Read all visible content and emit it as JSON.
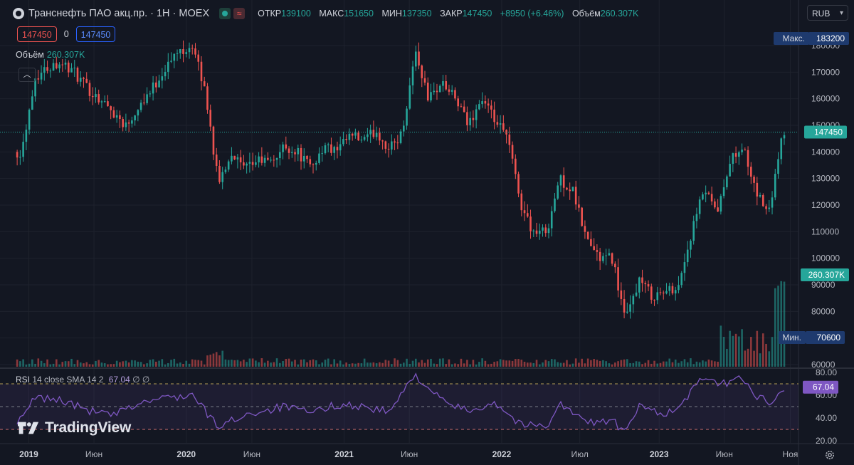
{
  "header": {
    "title": "Транснефть ПАО акц.пр. · 1Н · MOEX",
    "open_label": "ОТКР",
    "open_value": "139100",
    "high_label": "МАКС",
    "high_value": "151650",
    "low_label": "МИН",
    "low_value": "137350",
    "close_label": "ЗАКР",
    "close_value": "147450",
    "change_value": "+8950 (+6.46%)",
    "volume_label": "Объём",
    "volume_value": "260.307K"
  },
  "currency": "RUB",
  "trade_boxes": {
    "sell": "147450",
    "spread": "0",
    "buy": "147450"
  },
  "volume_legend": {
    "label": "Объём",
    "value": "260.307K"
  },
  "rsi_legend": {
    "label": "RSI",
    "params": "14 close SMA 14 2",
    "value": "67.04",
    "extra": "∅ ∅"
  },
  "brand": "TradingView",
  "colors": {
    "background": "#131722",
    "up": "#26a69a",
    "down": "#ef5350",
    "rsi": "#7e57c2",
    "grid": "#1e222d",
    "text": "#d1d4dc"
  },
  "icons": [
    "logo-icon",
    "eye-icon",
    "chevron-down-icon",
    "chevron-up-icon",
    "gear-icon"
  ],
  "chart_data": [
    {
      "type": "candlestick",
      "title": "Транснефть ПАО акц.пр. · 1Н · MOEX",
      "y_axis": {
        "ticks": [
          "180000",
          "170000",
          "160000",
          "150000",
          "140000",
          "130000",
          "120000",
          "110000",
          "100000",
          "90000",
          "80000",
          "70000",
          "60000"
        ],
        "range": [
          60000,
          180000
        ]
      },
      "x_axis": {
        "labels": [
          "2019",
          "Июн",
          "2020",
          "Июн",
          "2021",
          "Июн",
          "2022",
          "Июл",
          "2023",
          "Июн",
          "Ноя"
        ]
      },
      "price_badges": {
        "max_label": "Макс.",
        "max": "183200",
        "last": "147450",
        "volume": "260.307K",
        "min_label": "Мин.",
        "min": "70600"
      },
      "anchors": [
        {
          "t": "2018-12",
          "v": 140000
        },
        {
          "t": "2019-01",
          "v": 168000
        },
        {
          "t": "2019-02",
          "v": 172000
        },
        {
          "t": "2019-03",
          "v": 174000
        },
        {
          "t": "2019-04",
          "v": 170000
        },
        {
          "t": "2019-05",
          "v": 164000
        },
        {
          "t": "2019-06",
          "v": 160000
        },
        {
          "t": "2019-07",
          "v": 155000
        },
        {
          "t": "2019-08",
          "v": 150000
        },
        {
          "t": "2019-09",
          "v": 158000
        },
        {
          "t": "2019-10",
          "v": 164000
        },
        {
          "t": "2019-11",
          "v": 172000
        },
        {
          "t": "2019-12",
          "v": 178000
        },
        {
          "t": "2020-01",
          "v": 180000
        },
        {
          "t": "2020-02",
          "v": 162000
        },
        {
          "t": "2020-03",
          "v": 128000
        },
        {
          "t": "2020-04",
          "v": 140000
        },
        {
          "t": "2020-05",
          "v": 133000
        },
        {
          "t": "2020-06",
          "v": 137000
        },
        {
          "t": "2020-07",
          "v": 136000
        },
        {
          "t": "2020-08",
          "v": 142000
        },
        {
          "t": "2020-09",
          "v": 140000
        },
        {
          "t": "2020-10",
          "v": 134000
        },
        {
          "t": "2020-11",
          "v": 142000
        },
        {
          "t": "2020-12",
          "v": 140000
        },
        {
          "t": "2021-01",
          "v": 146000
        },
        {
          "t": "2021-02",
          "v": 144000
        },
        {
          "t": "2021-03",
          "v": 148000
        },
        {
          "t": "2021-04",
          "v": 141000
        },
        {
          "t": "2021-05",
          "v": 147000
        },
        {
          "t": "2021-06",
          "v": 178000
        },
        {
          "t": "2021-07",
          "v": 160000
        },
        {
          "t": "2021-08",
          "v": 166000
        },
        {
          "t": "2021-09",
          "v": 160000
        },
        {
          "t": "2021-10",
          "v": 150000
        },
        {
          "t": "2021-11",
          "v": 160000
        },
        {
          "t": "2021-12",
          "v": 152000
        },
        {
          "t": "2022-01",
          "v": 145000
        },
        {
          "t": "2022-02",
          "v": 120000
        },
        {
          "t": "2022-03",
          "v": 110000
        },
        {
          "t": "2022-04",
          "v": 110000
        },
        {
          "t": "2022-05",
          "v": 130000
        },
        {
          "t": "2022-06",
          "v": 125000
        },
        {
          "t": "2022-07",
          "v": 108000
        },
        {
          "t": "2022-08",
          "v": 100000
        },
        {
          "t": "2022-09",
          "v": 100000
        },
        {
          "t": "2022-10",
          "v": 76000
        },
        {
          "t": "2022-11",
          "v": 92000
        },
        {
          "t": "2022-12",
          "v": 86000
        },
        {
          "t": "2023-01",
          "v": 87000
        },
        {
          "t": "2023-02",
          "v": 90000
        },
        {
          "t": "2023-03",
          "v": 108000
        },
        {
          "t": "2023-04",
          "v": 126000
        },
        {
          "t": "2023-05",
          "v": 116000
        },
        {
          "t": "2023-06",
          "v": 138000
        },
        {
          "t": "2023-07",
          "v": 142000
        },
        {
          "t": "2023-08",
          "v": 124000
        },
        {
          "t": "2023-09",
          "v": 118000
        },
        {
          "t": "2023-10",
          "v": 147450
        }
      ]
    },
    {
      "type": "line",
      "title": "RSI 14 close SMA 14 2",
      "y_axis": {
        "ticks": [
          "80.00",
          "60.00",
          "40.00",
          "20.00"
        ],
        "range": [
          20,
          80
        ],
        "bands": [
          30,
          70
        ]
      },
      "last_value": "67.04",
      "anchors": [
        {
          "t": "2018-12",
          "v": 38
        },
        {
          "t": "2019-01",
          "v": 58
        },
        {
          "t": "2019-03",
          "v": 56
        },
        {
          "t": "2019-05",
          "v": 47
        },
        {
          "t": "2019-07",
          "v": 42
        },
        {
          "t": "2019-09",
          "v": 53
        },
        {
          "t": "2019-11",
          "v": 58
        },
        {
          "t": "2020-01",
          "v": 60
        },
        {
          "t": "2020-03",
          "v": 32
        },
        {
          "t": "2020-05",
          "v": 43
        },
        {
          "t": "2020-08",
          "v": 50
        },
        {
          "t": "2020-10",
          "v": 44
        },
        {
          "t": "2020-12",
          "v": 52
        },
        {
          "t": "2021-02",
          "v": 50
        },
        {
          "t": "2021-04",
          "v": 45
        },
        {
          "t": "2021-06",
          "v": 78
        },
        {
          "t": "2021-08",
          "v": 55
        },
        {
          "t": "2021-10",
          "v": 46
        },
        {
          "t": "2021-12",
          "v": 54
        },
        {
          "t": "2022-02",
          "v": 34
        },
        {
          "t": "2022-04",
          "v": 33
        },
        {
          "t": "2022-05",
          "v": 53
        },
        {
          "t": "2022-07",
          "v": 36
        },
        {
          "t": "2022-09",
          "v": 38
        },
        {
          "t": "2022-10",
          "v": 26
        },
        {
          "t": "2022-11",
          "v": 50
        },
        {
          "t": "2023-01",
          "v": 44
        },
        {
          "t": "2023-02",
          "v": 48
        },
        {
          "t": "2023-03",
          "v": 62
        },
        {
          "t": "2023-04",
          "v": 78
        },
        {
          "t": "2023-05",
          "v": 68
        },
        {
          "t": "2023-07",
          "v": 76
        },
        {
          "t": "2023-08",
          "v": 58
        },
        {
          "t": "2023-09",
          "v": 54
        },
        {
          "t": "2023-10",
          "v": 67.04
        }
      ]
    }
  ]
}
